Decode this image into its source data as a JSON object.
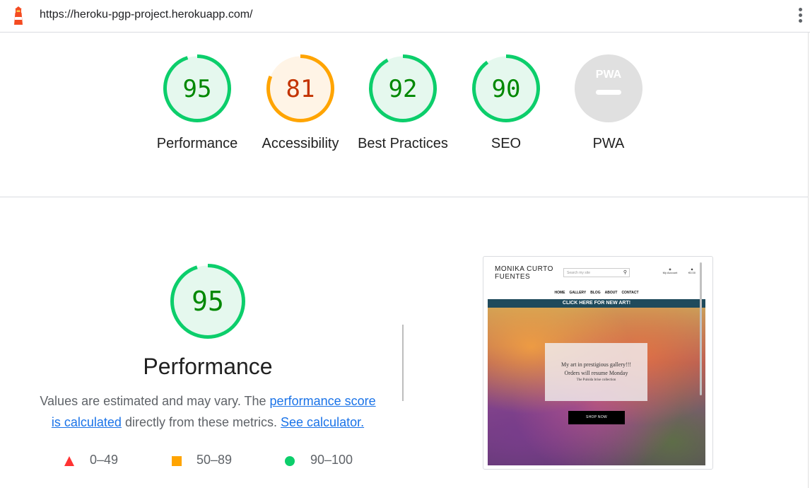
{
  "header": {
    "url": "https://heroku-pgp-project.herokuapp.com/",
    "logo_icon": "lighthouse-icon",
    "menu_icon": "more-vert-icon"
  },
  "colors": {
    "pass": "#0cce6b",
    "pass_text": "#008800",
    "pass_fill": "#e5f8ee",
    "average": "#ffa400",
    "average_text": "#c33300",
    "average_fill": "#fff4e6",
    "fail": "#ff3333",
    "na": "#e0e0e0",
    "link": "#1a73e8"
  },
  "categories": [
    {
      "label": "Performance",
      "score": 95,
      "rating": "pass"
    },
    {
      "label": "Accessibility",
      "score": 81,
      "rating": "average"
    },
    {
      "label": "Best Practices",
      "score": 92,
      "rating": "pass"
    },
    {
      "label": "SEO",
      "score": 90,
      "rating": "pass"
    },
    {
      "label": "PWA",
      "score": null,
      "rating": "na",
      "badge": "PWA"
    }
  ],
  "performance": {
    "score": 95,
    "title": "Performance",
    "desc_prefix": "Values are estimated and may vary. The ",
    "link1": "performance score is calculated",
    "desc_middle": " directly from these metrics. ",
    "link2": "See calculator.",
    "legend": [
      {
        "range": "0–49",
        "shape": "triangle"
      },
      {
        "range": "50–89",
        "shape": "square"
      },
      {
        "range": "90–100",
        "shape": "circle"
      }
    ]
  },
  "screenshot": {
    "brand_line1": "MONIKA CURTO",
    "brand_line2": "FUENTES",
    "search_placeholder": "Search my site",
    "account_label": "My Account",
    "cart_label": "€0.00",
    "nav": [
      "HOME",
      "GALLERY",
      "BLOG",
      "ABOUT",
      "CONTACT"
    ],
    "banner": "CLICK HERE FOR NEW ART!",
    "hero_line1": "My art in prestigious gallery!!!",
    "hero_line2": "Orders will resume Monday",
    "hero_line3": "The Pulsida brise collection",
    "hero_button": "SHOP NOW"
  }
}
